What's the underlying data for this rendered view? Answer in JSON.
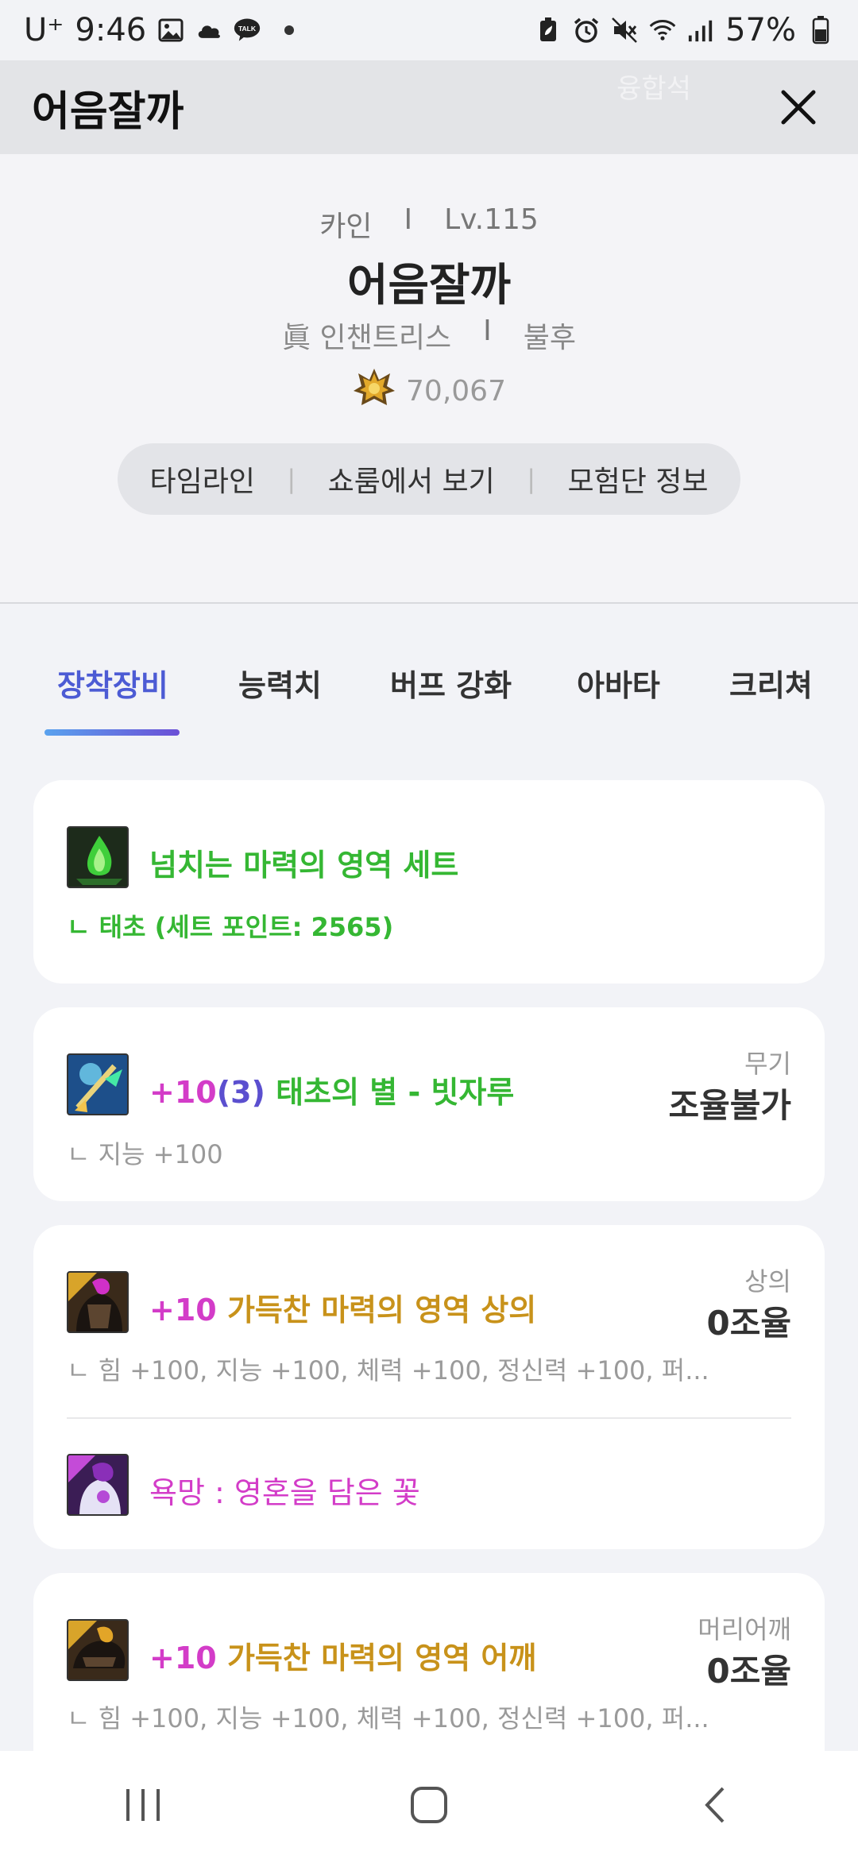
{
  "status_bar": {
    "carrier": "U⁺",
    "time": "9:46",
    "battery": "57%",
    "icons": [
      "gallery-icon",
      "cloud-icon",
      "kakaotalk-icon",
      "battery-saver-icon",
      "alarm-icon",
      "mute-icon",
      "wifi-icon",
      "signal-icon",
      "battery-icon"
    ],
    "talk_label": "TALK"
  },
  "header": {
    "title": "어음잘까",
    "ghost_text": "융합석"
  },
  "profile": {
    "server": "카인",
    "level": "Lv.115",
    "name": "어음잘까",
    "job": "眞 인챈트리스",
    "guild": "불후",
    "score": "70,067",
    "separator": "I",
    "menu": {
      "timeline": "타임라인",
      "showroom": "쇼룸에서 보기",
      "adventure": "모험단 정보",
      "separator": "|"
    }
  },
  "tabs": [
    {
      "label": "장착장비",
      "active": true
    },
    {
      "label": "능력치"
    },
    {
      "label": "버프 강화"
    },
    {
      "label": "아바타"
    },
    {
      "label": "크리쳐"
    }
  ],
  "set_card": {
    "name": "넘치는 마력의 영역 세트",
    "detail": "ㄴ 태초 (세트 포인트: 2565)"
  },
  "weapon": {
    "enhance": "+10",
    "refine": "(3)",
    "name": "태초의 별 - 빗자루",
    "stat": "ㄴ 지능 +100",
    "slot": "무기",
    "tune": "조율불가"
  },
  "top": {
    "enhance": "+10",
    "name": "가득찬 마력의 영역 상의",
    "stat": "ㄴ 힘 +100, 지능 +100, 체력 +100, 정신력 +100, 퍼...",
    "slot": "상의",
    "tune": "0조율",
    "sub_item": "욕망 : 영혼을 담은 꽃"
  },
  "shoulder": {
    "enhance": "+10",
    "name": "가득찬 마력의 영역 어깨",
    "stat": "ㄴ 힘 +100, 지능 +100, 체력 +100, 정신력 +100, 퍼...",
    "slot": "머리어깨",
    "tune": "0조율"
  },
  "colors": {
    "accent": "#4c5bd4",
    "set_green": "#35b733",
    "epic_gold": "#c8921a",
    "enhance_pink": "#d33cc8",
    "refine_purple": "#5b4fcf"
  }
}
